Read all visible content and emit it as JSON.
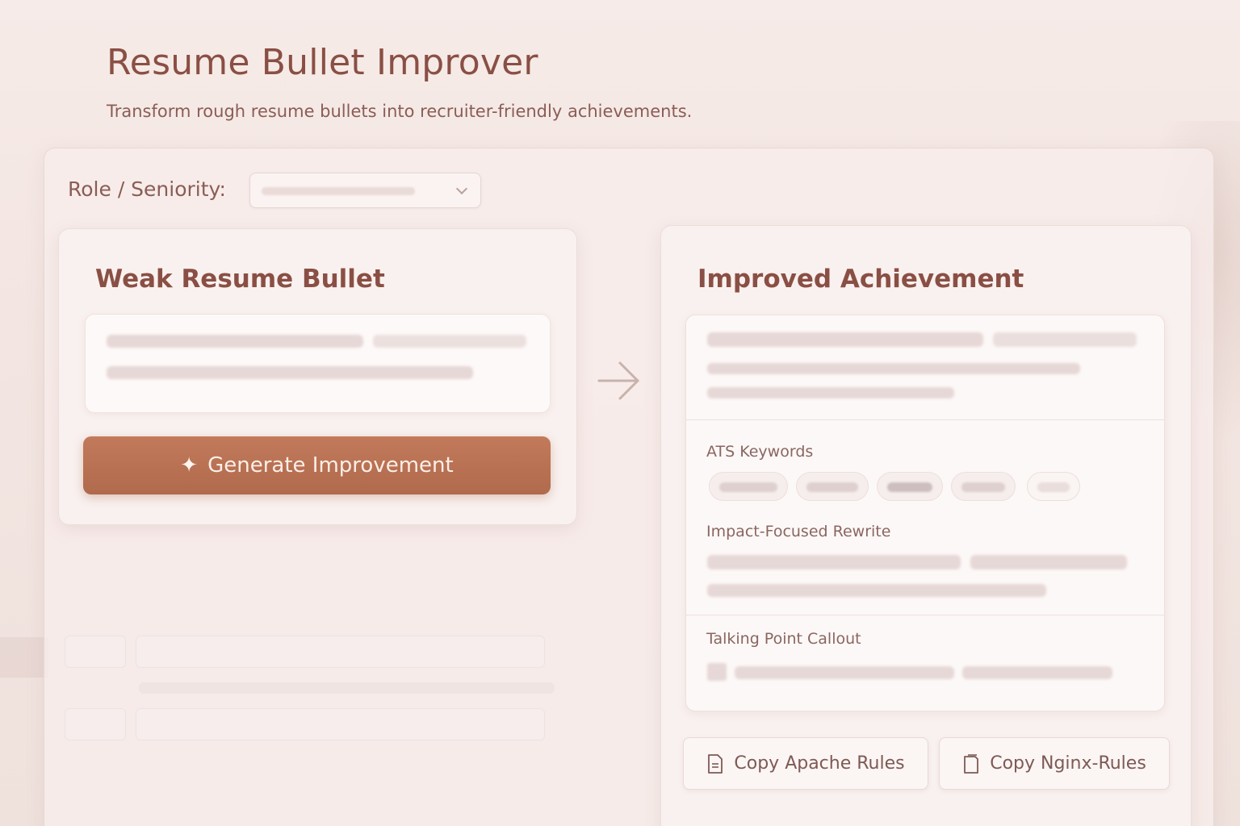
{
  "header": {
    "title": "Resume Bullet Improver",
    "subtitle": "Transform rough resume bullets into recruiter-friendly achievements."
  },
  "role": {
    "label": "Role / Seniority:"
  },
  "left_card": {
    "title": "Weak Resume Bullet",
    "generate_label": "Generate Improvement"
  },
  "right_card": {
    "title": "Improved Achievement",
    "ats_label": "ATS Keywords",
    "rewrite_label": "Impact-Focused Rewrite",
    "callout_label": "Talking Point Callout"
  },
  "actions": {
    "copy_apache": "Copy Apache Rules",
    "copy_nginx": "Copy Nginx-Rules"
  },
  "colors": {
    "accent": "#b9704f",
    "title": "#8a4f44",
    "background": "#f4e7e3"
  },
  "icons": {
    "sparkle": "sparkle-icon",
    "arrow": "arrow-right-icon",
    "chevron": "chevron-down-icon",
    "document": "document-icon"
  }
}
